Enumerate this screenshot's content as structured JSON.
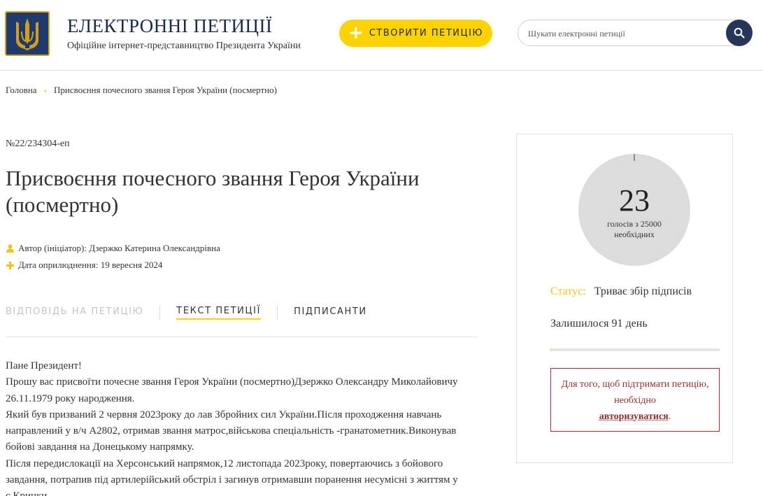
{
  "header": {
    "title": "ЕЛЕКТРОННІ ПЕТИЦІЇ",
    "subtitle": "Офіційне інтернет-представництво Президента України",
    "create_button": "СТВОРИТИ ПЕТИЦІЮ",
    "search_placeholder": "Шукати електронні петиції",
    "logo_icon": "trident-coat-of-arms-icon",
    "accent_color": "#ffd200",
    "brand_color": "#26365a"
  },
  "breadcrumb": {
    "home": "Головна",
    "current": "Присвоєння почесного звання Героя України (посмертно)"
  },
  "petition": {
    "number": "№22/234304-еп",
    "title": "Присвоєння почесного звання Героя України (посмертно)",
    "author_label": "Автор (ініціатор):",
    "author_name": "Дзержко Катерина Олександрівна",
    "date_label": "Дата оприлюднення:",
    "date_value": "19 вересня 2024",
    "tabs": [
      {
        "label": "ВІДПОВІДЬ НА ПЕТИЦІЮ",
        "state": "disabled"
      },
      {
        "label": "ТЕКСТ ПЕТИЦІЇ",
        "state": "active"
      },
      {
        "label": "ПІДПИСАНТИ",
        "state": "normal"
      }
    ],
    "text": [
      "Пане Президент!",
      "Прошу вас присвоїти почесне звання Героя України (посмертно)Дзержко Олександру Миколайовичу 26.11.1979 року народження.",
      "Який був призваний 2 червня 2023року до лав Збройних сил України.Після проходження навчань направлений у в/ч А2802, отримав звання матрос,військова спеціальність -гранатометник.Виконував бойові завдання на Донецькому напрямку.",
      "Після передислокації на Херсонський напрямок,12 листопада 2023року, повертаючись з бойового завдання, потрапив під артилерійський обстріл і загинув отримавши поранення несумісні з життям у с.Кринки."
    ]
  },
  "sidebar": {
    "votes_count": "23",
    "votes_of_line1": "голосів з 25000",
    "votes_of_line2": "необхідних",
    "votes_progress_fraction": 0.00092,
    "status_label": "Статус:",
    "status_value": "Триває збір підписів",
    "remaining": "Залишилося 91 день",
    "auth_text_before": "Для того, щоб підтримати петицію, необхідно",
    "auth_link": "авторизуватися",
    "auth_text_after": "."
  }
}
